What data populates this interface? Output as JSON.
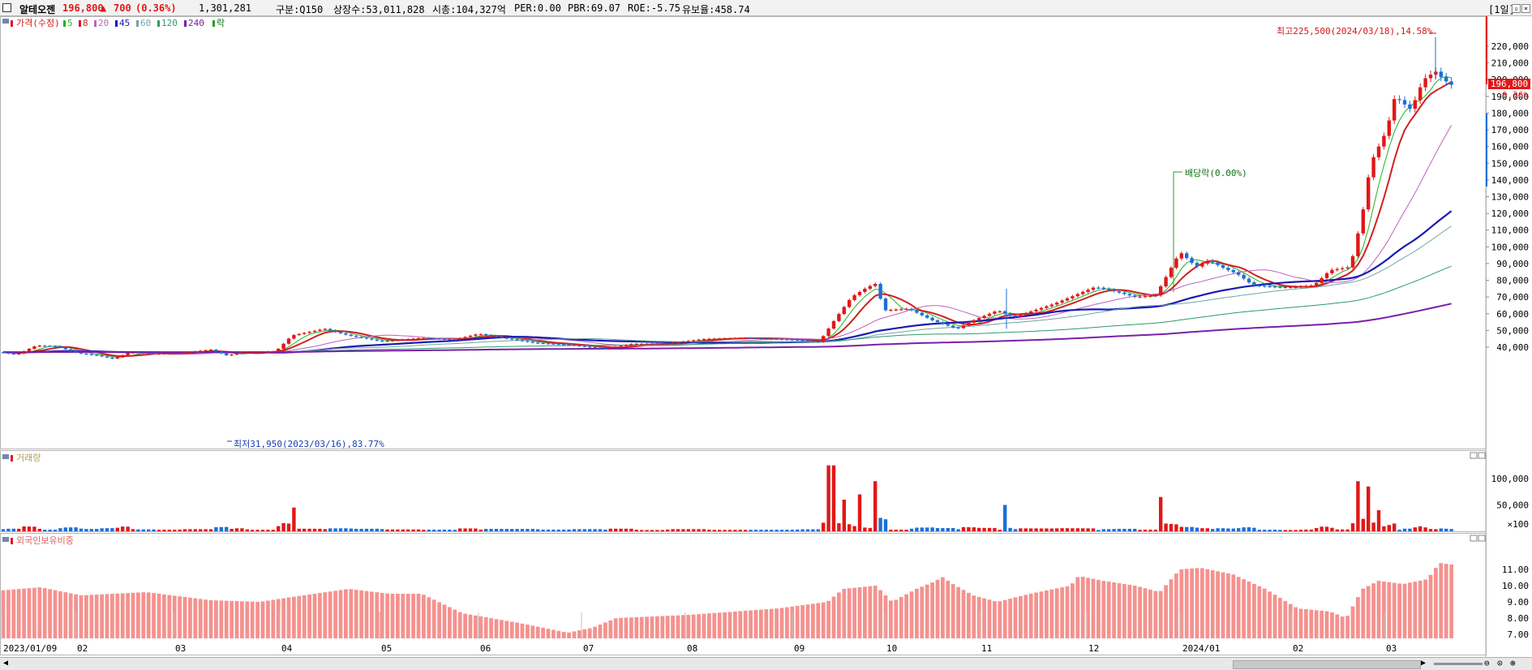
{
  "header": {
    "name": "알테오젠",
    "price": "196,800",
    "change_arrow": "▲",
    "change": "700",
    "change_pct": "(0.36%)",
    "volume": "1,301,281",
    "market": "구분:Q150",
    "listed": "상장수:53,011,828",
    "mktcap": "시총:104,327억",
    "per": "PER:0.00",
    "pbr": "PBR:69.07",
    "roe": "ROE:-5.75",
    "float": "유보율:458.74",
    "period": "[1일]"
  },
  "legend": {
    "price_label": "가격(수정)",
    "ma_labels": [
      "5",
      "8",
      "20",
      "45",
      "60",
      "120",
      "240"
    ],
    "ma_colors": [
      "#22b422",
      "#d02020",
      "#c060c0",
      "#1a1ab4",
      "#6fa6a6",
      "#2e9a6a",
      "#7a20a8"
    ],
    "event_label": "락"
  },
  "annotations": {
    "high": "최고225,500(2024/03/18),14.58%",
    "low": "최저31,950(2023/03/16),83.77%",
    "dividend": "배당락(0.00%)"
  },
  "price_axis": {
    "ticks": [
      "220,000",
      "210,000",
      "200,000",
      "190,000",
      "180,000",
      "170,000",
      "160,000",
      "150,000",
      "140,000",
      "130,000",
      "120,000",
      "110,000",
      "100,000",
      "90,000",
      "80,000",
      "70,000",
      "60,000",
      "50,000",
      "40,000"
    ],
    "current_tag": "196,800",
    "current_pct": "0.36%"
  },
  "volume_panel": {
    "label": "거래량",
    "ticks": [
      "100,000",
      "50,000"
    ],
    "unit": "×100"
  },
  "foreign_panel": {
    "label": "외국인보유비중",
    "ticks": [
      "11.00",
      "10.00",
      "9.00",
      "8.00",
      "7.00"
    ]
  },
  "x_axis": {
    "labels": [
      "2023/01/09",
      "02",
      "03",
      "04",
      "05",
      "06",
      "07",
      "08",
      "09",
      "10",
      "11",
      "12",
      "2024/01",
      "02",
      "03"
    ]
  },
  "colors": {
    "up": "#e01818",
    "down": "#1e6ed6",
    "bg": "#ffffff",
    "foreign_bar": "#f4928f"
  },
  "chart_data": {
    "type": "candlestick",
    "title": "알테오젠",
    "series": [
      {
        "name": "가격(수정)",
        "type": "candlestick",
        "x": [
          "2023-01",
          "2023-02",
          "2023-03",
          "2023-04",
          "2023-05",
          "2023-06",
          "2023-07",
          "2023-08",
          "2023-09",
          "2023-10",
          "2023-11",
          "2023-12",
          "2024-01",
          "2024-02",
          "2024-03"
        ],
        "values": [
          37000,
          41000,
          34000,
          51000,
          43000,
          46000,
          40000,
          44000,
          76000,
          60000,
          68000,
          74000,
          92000,
          77000,
          196800
        ]
      },
      {
        "name": "거래량",
        "type": "bar",
        "values": [
          4000,
          8000,
          6000,
          45000,
          8000,
          10000,
          6000,
          7000,
          120000,
          20000,
          15000,
          10000,
          60000,
          12000,
          90000
        ]
      },
      {
        "name": "외국인보유비중",
        "type": "bar",
        "values": [
          9.7,
          9.5,
          9.2,
          9.0,
          9.5,
          8.5,
          7.1,
          7.9,
          8.8,
          10.2,
          9.8,
          10.4,
          11.1,
          8.6,
          10.8
        ]
      }
    ],
    "ylim": [
      35000,
      230000
    ],
    "high": {
      "value": 225500,
      "date": "2024/03/18"
    },
    "low": {
      "value": 31950,
      "date": "2023/03/16"
    }
  }
}
